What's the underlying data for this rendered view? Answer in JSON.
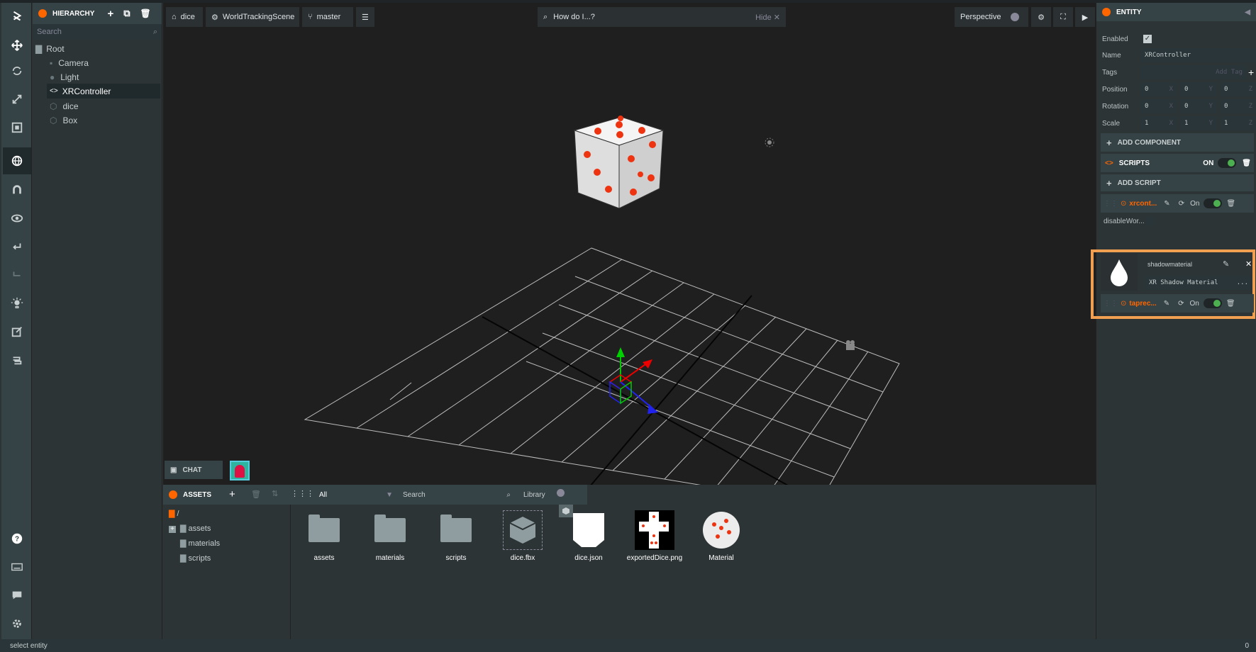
{
  "hierarchy": {
    "title": "HIERARCHY",
    "search_placeholder": "Search",
    "items": [
      "Root",
      "Camera",
      "Light",
      "XRController",
      "dice",
      "Box"
    ]
  },
  "viewport": {
    "breadcrumb": {
      "project": "dice",
      "scene": "WorldTrackingScene",
      "branch": "master"
    },
    "help_search": "How do I...?",
    "hide_label": "Hide",
    "camera_mode": "Perspective"
  },
  "entity": {
    "title": "ENTITY",
    "enabled_label": "Enabled",
    "name_label": "Name",
    "name_value": "XRController",
    "tags_label": "Tags",
    "tags_placeholder": "Add Tag",
    "position_label": "Position",
    "rotation_label": "Rotation",
    "scale_label": "Scale",
    "position": [
      "0",
      "0",
      "0"
    ],
    "rotation": [
      "0",
      "0",
      "0"
    ],
    "scale": [
      "1",
      "1",
      "1"
    ],
    "axes": [
      "X",
      "Y",
      "Z"
    ],
    "add_component": "ADD COMPONENT"
  },
  "scripts": {
    "title": "SCRIPTS",
    "state": "ON",
    "add_script": "ADD SCRIPT",
    "items": [
      {
        "name": "xrcont...",
        "state": "On"
      },
      {
        "name": "taprec...",
        "state": "On"
      }
    ],
    "attr_label": "disableWor...",
    "asset_title": "shadowmaterial",
    "asset_type": "XR Shadow Material",
    "asset_more": "..."
  },
  "chat": {
    "label": "CHAT"
  },
  "assets": {
    "title": "ASSETS",
    "filter": "All",
    "search_placeholder": "Search",
    "library": "Library",
    "root": "/",
    "folders": [
      "assets",
      "materials",
      "scripts"
    ],
    "items": [
      "assets",
      "materials",
      "scripts",
      "dice.fbx",
      "dice.json",
      "exportedDice.png",
      "Material"
    ]
  },
  "status": {
    "text": "select entity",
    "right": "0"
  },
  "colors": {
    "accent": "#ff6600",
    "highlight": "#f0a050",
    "panel": "#2d3436",
    "viewport": "#1f1f1f"
  }
}
